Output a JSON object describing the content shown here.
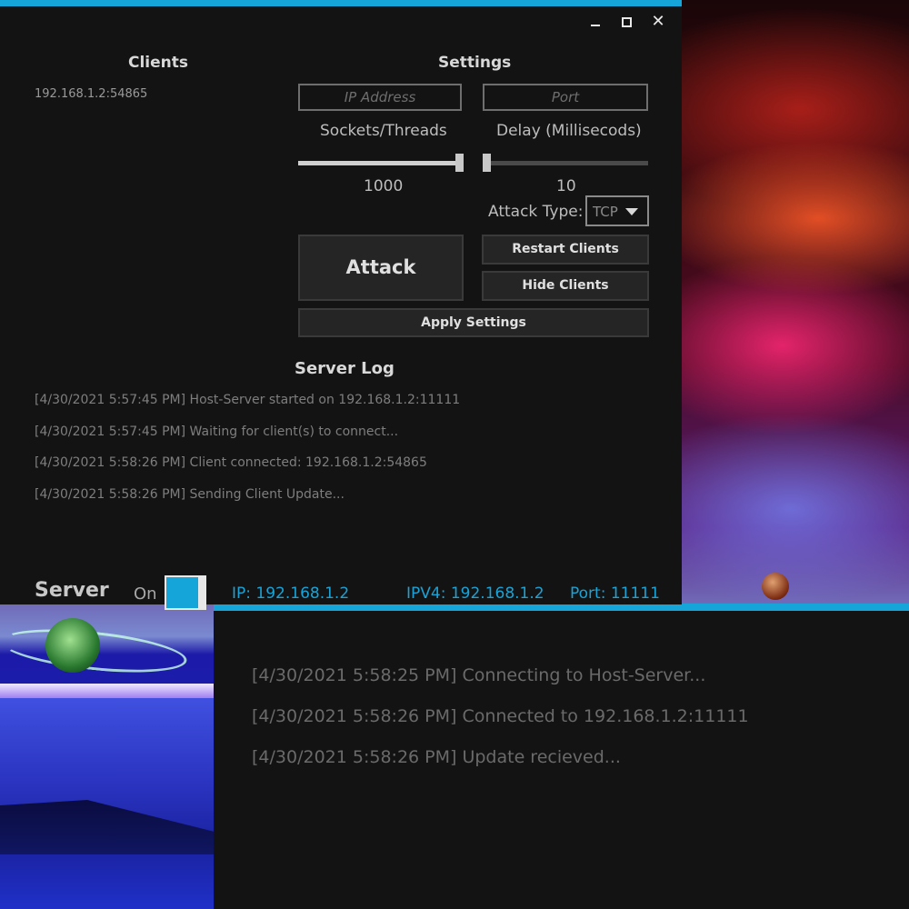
{
  "client_window": {
    "log": [
      "[4/30/2021 5:58:25 PM] Connecting to Host-Server...",
      "[4/30/2021 5:58:26 PM] Connected to 192.168.1.2:11111",
      "[4/30/2021 5:58:26 PM] Update recieved..."
    ]
  },
  "server_window": {
    "controls": {
      "minimize": "minimize-icon",
      "maximize": "maximize-icon",
      "close": "✕"
    },
    "clients": {
      "title": "Clients",
      "items": [
        "192.168.1.2:54865"
      ]
    },
    "settings": {
      "title": "Settings",
      "ip_placeholder": "IP Address",
      "port_placeholder": "Port",
      "sockets_label": "Sockets/Threads",
      "sockets_value": "1000",
      "sockets_level": 1.0,
      "delay_label": "Delay (Millisecods)",
      "delay_value": "10",
      "delay_level": 0.0,
      "attack_type_label": "Attack Type:",
      "attack_type_value": "TCP",
      "attack_button": "Attack",
      "restart_button": "Restart Clients",
      "hide_button": "Hide Clients",
      "apply_button": "Apply Settings"
    },
    "log": {
      "title": "Server Log",
      "lines": [
        "[4/30/2021 5:57:45 PM] Host-Server started on 192.168.1.2:11111",
        "[4/30/2021 5:57:45 PM] Waiting for client(s) to connect...",
        "[4/30/2021 5:58:26 PM] Client connected: 192.168.1.2:54865",
        "[4/30/2021 5:58:26 PM] Sending Client Update..."
      ]
    },
    "status": {
      "server_label": "Server",
      "on_label": "On",
      "toggle_on": true,
      "ip": "IP: 192.168.1.2",
      "ipv4": "IPV4: 192.168.1.2",
      "port": "Port: 11111"
    },
    "colors": {
      "accent": "#16a5d8",
      "background": "#131313"
    }
  }
}
